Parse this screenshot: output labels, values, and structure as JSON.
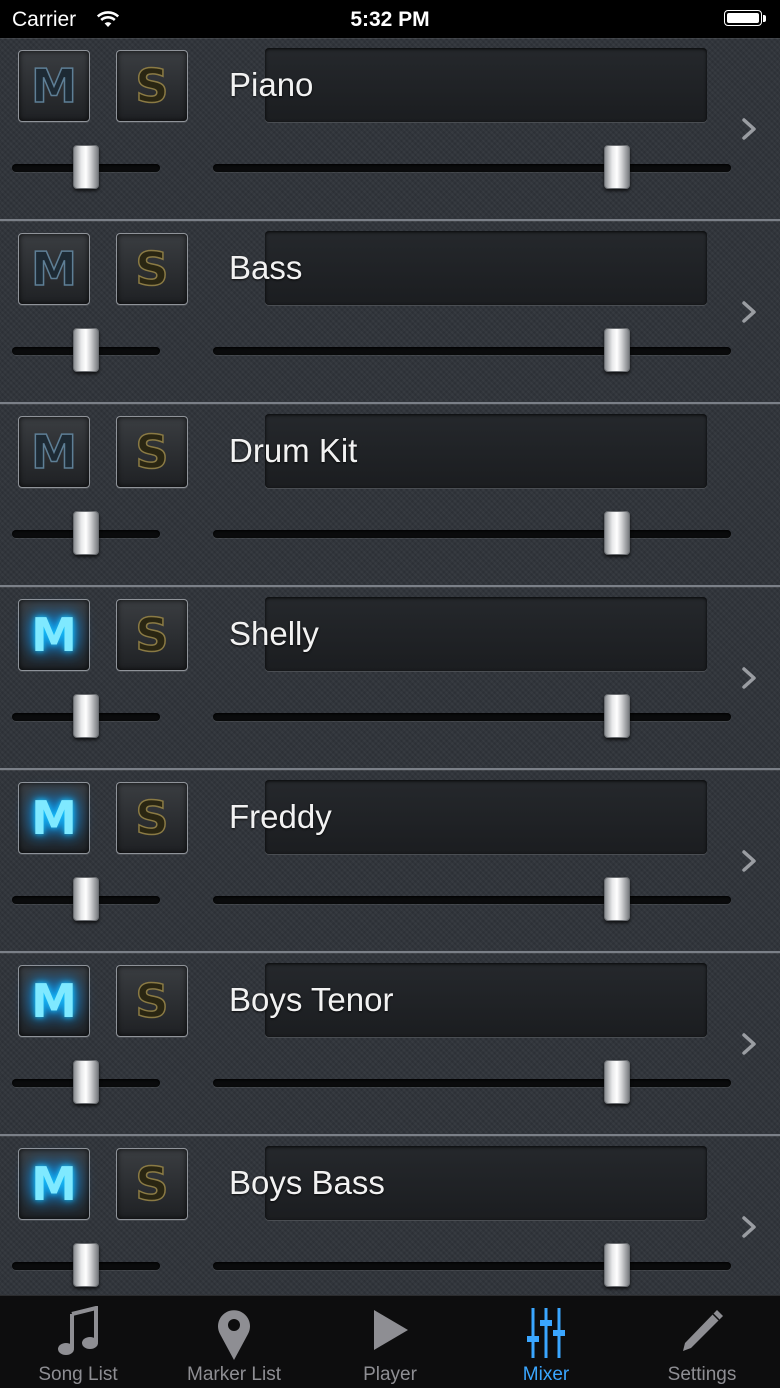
{
  "status_bar": {
    "carrier": "Carrier",
    "time": "5:32 PM"
  },
  "channels": [
    {
      "name": "Piano",
      "mute_label": "M",
      "solo_label": "S",
      "muted": false,
      "soloed": false,
      "has_chevron": true,
      "pan": 0.5,
      "volume": 0.78
    },
    {
      "name": "Bass",
      "mute_label": "M",
      "solo_label": "S",
      "muted": false,
      "soloed": false,
      "has_chevron": true,
      "pan": 0.5,
      "volume": 0.78
    },
    {
      "name": "Drum Kit",
      "mute_label": "M",
      "solo_label": "S",
      "muted": false,
      "soloed": false,
      "has_chevron": false,
      "pan": 0.5,
      "volume": 0.78
    },
    {
      "name": "Shelly",
      "mute_label": "M",
      "solo_label": "S",
      "muted": true,
      "soloed": false,
      "has_chevron": true,
      "pan": 0.5,
      "volume": 0.78
    },
    {
      "name": "Freddy",
      "mute_label": "M",
      "solo_label": "S",
      "muted": true,
      "soloed": false,
      "has_chevron": true,
      "pan": 0.5,
      "volume": 0.78
    },
    {
      "name": "Boys Tenor",
      "mute_label": "M",
      "solo_label": "S",
      "muted": true,
      "soloed": false,
      "has_chevron": true,
      "pan": 0.5,
      "volume": 0.78
    },
    {
      "name": "Boys Bass",
      "mute_label": "M",
      "solo_label": "S",
      "muted": true,
      "soloed": false,
      "has_chevron": true,
      "pan": 0.5,
      "volume": 0.78
    }
  ],
  "tabs": [
    {
      "label": "Song List",
      "icon": "music-note-icon",
      "active": false
    },
    {
      "label": "Marker List",
      "icon": "map-pin-icon",
      "active": false
    },
    {
      "label": "Player",
      "icon": "play-icon",
      "active": false
    },
    {
      "label": "Mixer",
      "icon": "mixer-sliders-icon",
      "active": true
    },
    {
      "label": "Settings",
      "icon": "pencil-icon",
      "active": false
    }
  ],
  "colors": {
    "accent": "#3aa6ff",
    "mute_glow": "#19c8ff",
    "tab_inactive": "#8e8e93"
  }
}
